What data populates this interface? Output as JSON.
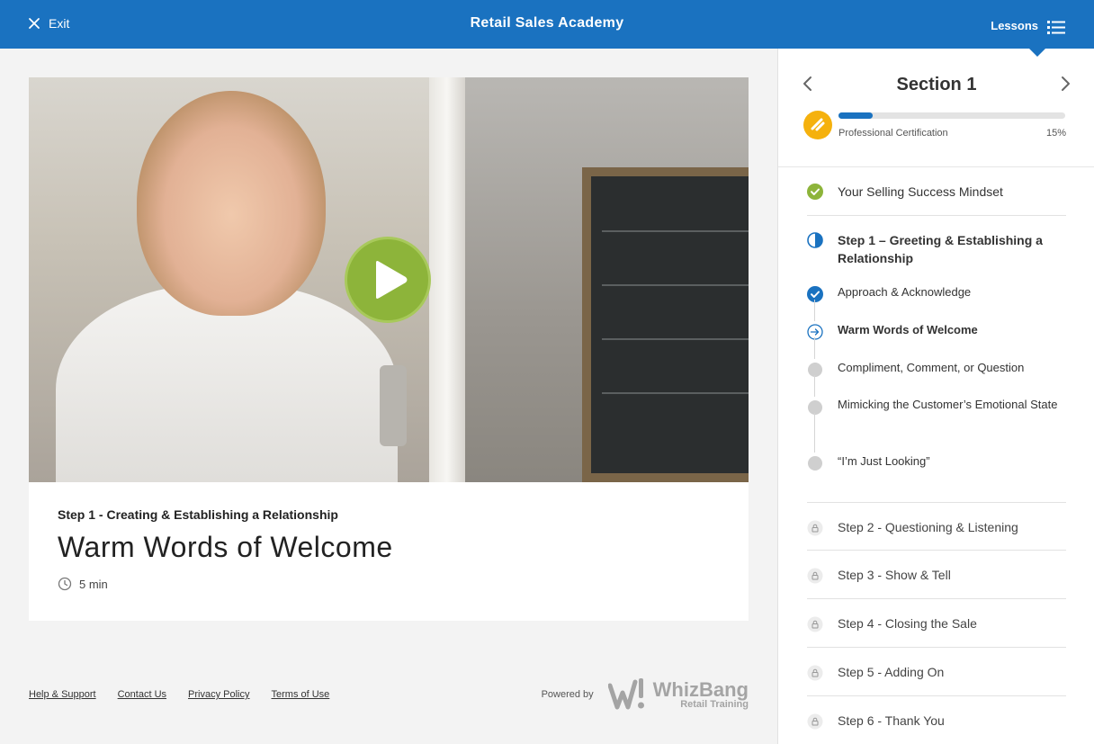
{
  "topbar": {
    "exit_label": "Exit",
    "app_title": "Retail Sales Academy",
    "lessons_label": "Lessons",
    "bg_color": "#1a72c0"
  },
  "video": {
    "section": "Step 1 - Creating & Establishing a Relationship",
    "title": "Warm Words of Welcome",
    "duration": "5 min",
    "play_color": "#8db43a"
  },
  "footer": {
    "links": [
      "Help & Support",
      "Contact Us",
      "Privacy Policy",
      "Terms of Use"
    ],
    "powered_by": "Powered by",
    "brand": "WhizBang",
    "brand_tagline": "Retail Training"
  },
  "sidebar": {
    "section_title": "Section 1",
    "certification_label": "Professional Certification",
    "progress_percent": 15,
    "progress_label": "15%",
    "items": [
      {
        "label": "Your Selling Success Mindset",
        "status": "complete"
      },
      {
        "label": "Step 1 – Greeting & Establishing a Relationship",
        "status": "in-progress"
      },
      {
        "label": "Approach & Acknowledge",
        "status": "complete"
      },
      {
        "label": "Warm Words of Welcome",
        "status": "current"
      },
      {
        "label": "Compliment, Comment, or Question",
        "status": "not-started"
      },
      {
        "label": "Mimicking the Customer’s Emotional State",
        "status": "not-started"
      },
      {
        "label": "“I’m Just Looking”",
        "status": "not-started"
      },
      {
        "label": "Step 2 - Questioning & Listening",
        "status": "locked"
      },
      {
        "label": "Step 3 - Show & Tell",
        "status": "locked"
      },
      {
        "label": "Step 4 - Closing the Sale",
        "status": "locked"
      },
      {
        "label": "Step 5 - Adding On",
        "status": "locked"
      },
      {
        "label": "Step 6 - Thank You",
        "status": "locked"
      }
    ]
  }
}
